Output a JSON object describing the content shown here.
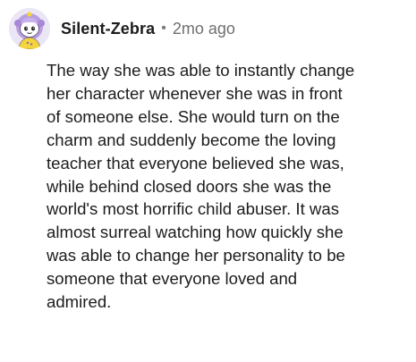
{
  "comment": {
    "author": "Silent-Zebra",
    "separator": "•",
    "timestamp": "2mo ago",
    "avatar_icon": "snoovatar-icon",
    "body_lines": [
      "The way she was able to instantly change",
      "her character whenever she was in front",
      "of someone else. She would turn on the",
      "charm and suddenly become the loving",
      "teacher that everyone believed she was,",
      "while behind closed doors she was the",
      "world's most horrific child abuser. It was",
      "almost surreal watching how quickly she",
      "was able to change her personality to be",
      "someone that everyone loved and",
      "admired."
    ]
  },
  "colors": {
    "background": "#ffffff",
    "text": "#1c1c1c",
    "meta_text": "#6f6f6f",
    "avatar_bg": "#e8e4f4",
    "avatar_hair": "#b69ad8",
    "avatar_shirt": "#f3d43a"
  }
}
